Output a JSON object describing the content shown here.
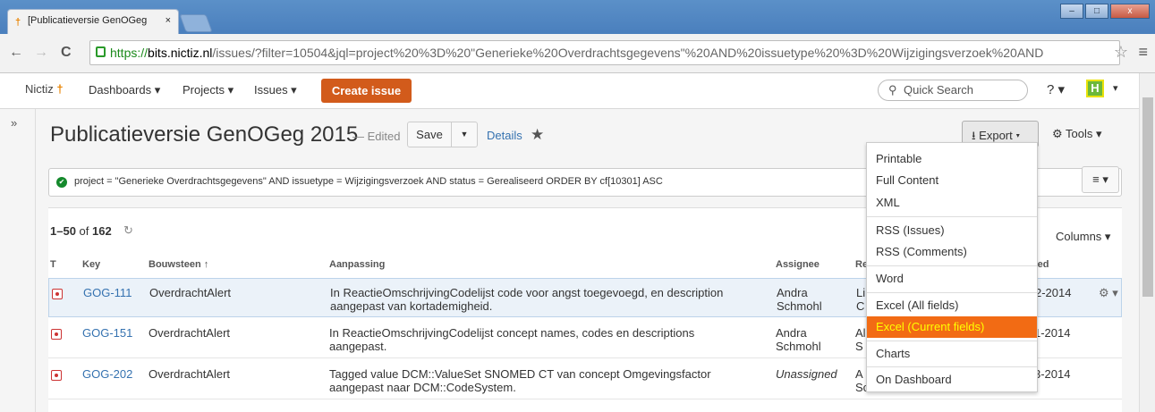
{
  "browser": {
    "tab_title": "[Publicatieversie GenOGeg",
    "tab_close": "×",
    "url_https": "https://",
    "url_host": "bits.nictiz.nl",
    "url_rest": "/issues/?filter=10504&jql=project%20%3D%20\"Generieke%20Overdrachtsgegevens\"%20AND%20issuetype%20%3D%20Wijzigingsverzoek%20AND"
  },
  "header": {
    "logo": "Nictiz",
    "nav": [
      "Dashboards ▾",
      "Projects ▾",
      "Issues ▾"
    ],
    "create": "Create issue",
    "search_placeholder": "Quick Search",
    "help": "? ▾",
    "avatar": "H"
  },
  "page": {
    "title": "Publicatieversie GenOGeg 2015",
    "edited": "— Edited",
    "save": "Save",
    "details": "Details",
    "export": "Export ▾",
    "tools": "Tools ▾",
    "jql": "project = \"Generieke Overdrachtsgegevens\" AND issuetype = Wijzigingsverzoek AND status = Gerealiseerd ORDER BY cf[10301] ASC",
    "count_range": "1–50",
    "count_of": "of",
    "count_total": "162",
    "columns": "Columns ▾"
  },
  "table": {
    "headers": [
      "T",
      "Key",
      "Bouwsteen ↑",
      "Aanpassing",
      "Assignee",
      "Re",
      "ted"
    ],
    "rows": [
      {
        "key": "GOG-111",
        "bouwsteen": "OverdrachtAlert",
        "aanpassing1": "In ReactieOmschrijvingCodelijst code voor angst toegevoegd, en description",
        "aanpassing2": "aangepast van kortademigheid.",
        "assignee1": "Andra",
        "assignee2": "Schmohl",
        "rep1": "Li",
        "rep2": "C",
        "date": "2-2014"
      },
      {
        "key": "GOG-151",
        "bouwsteen": "OverdrachtAlert",
        "aanpassing1": "In ReactieOmschrijvingCodelijst concept names, codes en descriptions",
        "aanpassing2": "aangepast.",
        "assignee1": "Andra",
        "assignee2": "Schmohl",
        "rep1": "Al",
        "rep2": "S",
        "date": "1-2014"
      },
      {
        "key": "GOG-202",
        "bouwsteen": "OverdrachtAlert",
        "aanpassing1": "Tagged value DCM::ValueSet SNOMED CT van concept Omgevingsfactor",
        "aanpassing2": "aangepast naar DCM::CodeSystem.",
        "assignee1": "Unassigned",
        "assignee2": "",
        "rep1": "A",
        "rep2": "Schmohl",
        "date": "3-2014"
      }
    ]
  },
  "export_menu": [
    "Printable",
    "Full Content",
    "XML",
    "RSS (Issues)",
    "RSS (Comments)",
    "Word",
    "Excel (All fields)",
    "Excel (Current fields)",
    "Charts",
    "On Dashboard"
  ]
}
